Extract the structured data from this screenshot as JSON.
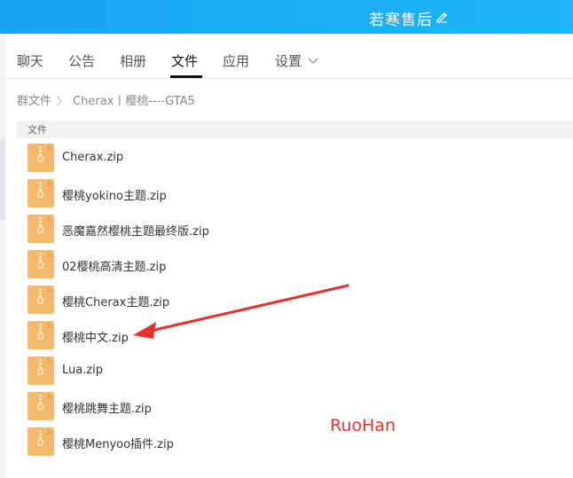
{
  "window": {
    "title": "若寒售后"
  },
  "tabs": [
    {
      "label": "聊天"
    },
    {
      "label": "公告"
    },
    {
      "label": "相册"
    },
    {
      "label": "文件"
    },
    {
      "label": "应用"
    },
    {
      "label": "设置"
    }
  ],
  "active_tab": "文件",
  "breadcrumb": {
    "root": "群文件",
    "sep": "〉",
    "current": "Cherax丨樱桃----GTA5"
  },
  "list_header": "文件",
  "files": [
    {
      "name": "Cherax.zip"
    },
    {
      "name": "樱桃yokino主题.zip"
    },
    {
      "name": "恶魔嘉然樱桃主题最终版.zip"
    },
    {
      "name": "02樱桃高清主题.zip"
    },
    {
      "name": "樱桃Cherax主题.zip"
    },
    {
      "name": "樱桃中文.zip"
    },
    {
      "name": "Lua.zip"
    },
    {
      "name": "樱桃跳舞主题.zip"
    },
    {
      "name": "樱桃Menyoo插件.zip"
    }
  ],
  "annotation": {
    "arrow_points_to": "樱桃中文.zip",
    "color": "#e8312b"
  },
  "watermark": "RuoHan",
  "colors": {
    "titlebar": "#1aa8f5",
    "zip_icon": "#f6b86a",
    "accent_red": "#e8312b"
  },
  "icons": {
    "edit": "pencil-icon",
    "settings_dropdown": "chevron-down-icon",
    "file": "zip-file-icon"
  }
}
